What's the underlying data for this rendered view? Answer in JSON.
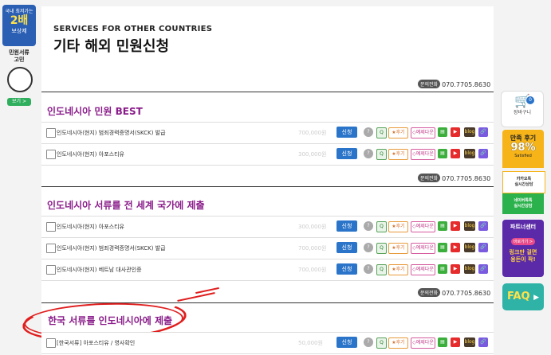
{
  "left_banner": {
    "top_line": "국내 최저가는",
    "big": "2배",
    "sub": "보상제",
    "mid": "민원서류\n고민",
    "button": "보기 >"
  },
  "header": {
    "en_title": "SERVICES FOR OTHER COUNTRIES",
    "ko_title": "기타 해외 민원신청"
  },
  "phone": {
    "tag": "문의전화",
    "number": "070.7705.8630"
  },
  "sections": [
    {
      "title": "인도네시아 민원 BEST",
      "rows": [
        {
          "label": "인도네시아(현지) 범죄경력증명서(SKCK) 발급",
          "price": "700,000원"
        },
        {
          "label": "인도네시아(현지) 아포스티유",
          "price": "300,000원"
        }
      ]
    },
    {
      "title": "인도네시아 서류를 전 세계 국가에 제출",
      "rows": [
        {
          "label": "인도네시아(현지) 아포스티유",
          "price": "300,000원"
        },
        {
          "label": "인도네시아(현지) 범죄경력증명서(SKCK) 발급",
          "price": "700,000원"
        },
        {
          "label": "인도네시아(현지) 베트남 대사관인증",
          "price": "700,000원"
        }
      ]
    },
    {
      "title": "한국 서류를 인도네시아에 제출",
      "rows": [
        {
          "label": "[한국서류] 아포스티유 / 영사확인",
          "price": "50,000원"
        }
      ]
    }
  ],
  "row_buttons": {
    "apply": "신청",
    "q": "?",
    "s": "Q",
    "review": "★후기",
    "download": "◇예제다운",
    "g": "▤",
    "y": "▶",
    "b": "blog",
    "link": "🔗"
  },
  "right_sidebar": {
    "cart_badge": "0",
    "cart_label": "장바구니",
    "review_title": "만족 후기",
    "review_pct": "98%",
    "review_sub": "Satisfied",
    "kakao": "카카오톡\n실시간상담",
    "naver": "네이버톡톡\n실시간상담",
    "partner_title": "파트너센터",
    "partner_tag": "바로가기 >",
    "partner_text": "링크만 걸면\n용돈이 팍!",
    "faq": "FAQ"
  },
  "colors": {
    "section_title": "#8a1c8a",
    "apply_button": "#2a74c9",
    "annotation": "#e01e1e"
  }
}
